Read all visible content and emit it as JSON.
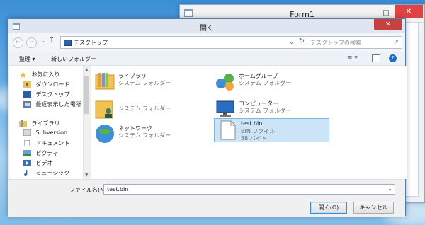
{
  "background_window": {
    "title": "Form1",
    "controls": {
      "minimize": "–",
      "maximize": "□",
      "close": "✕"
    }
  },
  "dialog": {
    "title": "開く",
    "close_glyph": "✕",
    "nav": {
      "back": "←",
      "forward": "→",
      "recent": "⌄",
      "up": "↑",
      "address": "デスクトップ",
      "address_chevron": "›",
      "address_dropdown": "⌄",
      "refresh": "↻",
      "search_placeholder": "デスクトップの検索",
      "search_icon": "⌕"
    },
    "toolbar": {
      "organize": "整理 ▾",
      "new_folder": "新しいフォルダー",
      "views": "≡ ▾",
      "help": "?"
    },
    "sidebar": {
      "favorites_header": "お気に入り",
      "favorites": [
        "ダウンロード",
        "デスクトップ",
        "最近表示した場所"
      ],
      "libraries_header": "ライブラリ",
      "libraries": [
        "Subversion",
        "ドキュメント",
        "ピクチャ",
        "ビデオ",
        "ミュージック"
      ]
    },
    "files": [
      {
        "name": "ライブラリ",
        "type": "システム フォルダー",
        "size": "",
        "icon": "library-folder-icon"
      },
      {
        "name": "ホームグループ",
        "type": "システム フォルダー",
        "size": "",
        "icon": "homegroup-icon"
      },
      {
        "name": "",
        "type": "システム フォルダー",
        "size": "",
        "icon": "user-folder-icon"
      },
      {
        "name": "コンピューター",
        "type": "システム フォルダー",
        "size": "",
        "icon": "computer-icon"
      },
      {
        "name": "ネットワーク",
        "type": "システム フォルダー",
        "size": "",
        "icon": "network-icon"
      },
      {
        "name": "test.bin",
        "type": "BIN ファイル",
        "size": "58 バイト",
        "icon": "file-icon"
      }
    ],
    "filename_label": "ファイル名(N):",
    "filename_value": "test.bin",
    "filename_dropdown": "⌄",
    "open_button": "開く(O)",
    "cancel_button": "キャンセル"
  },
  "colors": {
    "selection": "#cce4f7",
    "close_red": "#c7423e",
    "accent": "#3f8fd6"
  }
}
